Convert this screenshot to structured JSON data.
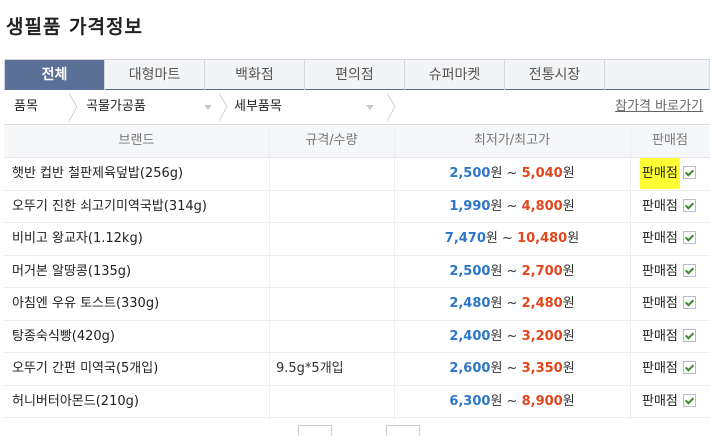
{
  "page": {
    "title": "생필품 가격정보"
  },
  "tabs": [
    {
      "label": "전체",
      "active": true
    },
    {
      "label": "대형마트",
      "active": false
    },
    {
      "label": "백화점",
      "active": false
    },
    {
      "label": "편의점",
      "active": false
    },
    {
      "label": "슈퍼마켓",
      "active": false
    },
    {
      "label": "전통시장",
      "active": false
    }
  ],
  "filter": {
    "category_label": "품목",
    "category_value": "곡물가공품",
    "subcategory_value": "세부품목",
    "reference_link": "참가격 바로가기"
  },
  "table": {
    "headers": {
      "brand": "브랜드",
      "spec": "규격/수량",
      "price": "최저가/최고가",
      "store": "판매점"
    },
    "price_separator": "~",
    "currency_unit": "원",
    "rows": [
      {
        "brand": "햇반 컵반 철판제육덮밥(256g)",
        "spec": "",
        "min": "2,500",
        "max": "5,040",
        "store": "판매점"
      },
      {
        "brand": "오뚜기 진한 쇠고기미역국밥(314g)",
        "spec": "",
        "min": "1,990",
        "max": "4,800",
        "store": "판매점"
      },
      {
        "brand": "비비고 왕교자(1.12kg)",
        "spec": "",
        "min": "7,470",
        "max": "10,480",
        "store": "판매점"
      },
      {
        "brand": "머거본 알땅콩(135g)",
        "spec": "",
        "min": "2,500",
        "max": "2,700",
        "store": "판매점"
      },
      {
        "brand": "아침엔 우유 토스트(330g)",
        "spec": "",
        "min": "2,480",
        "max": "2,480",
        "store": "판매점"
      },
      {
        "brand": "탕종숙식빵(420g)",
        "spec": "",
        "min": "2,400",
        "max": "3,200",
        "store": "판매점"
      },
      {
        "brand": "오뚜기 간편 미역국(5개입)",
        "spec": "9.5g*5개입",
        "min": "2,600",
        "max": "3,350",
        "store": "판매점"
      },
      {
        "brand": "허니버터아몬드(210g)",
        "spec": "",
        "min": "6,300",
        "max": "8,900",
        "store": "판매점"
      }
    ]
  },
  "colors": {
    "tab_active": "#5b7096",
    "price_min": "#2c77c9",
    "price_max": "#e2461c",
    "highlight": "#ffff33"
  }
}
